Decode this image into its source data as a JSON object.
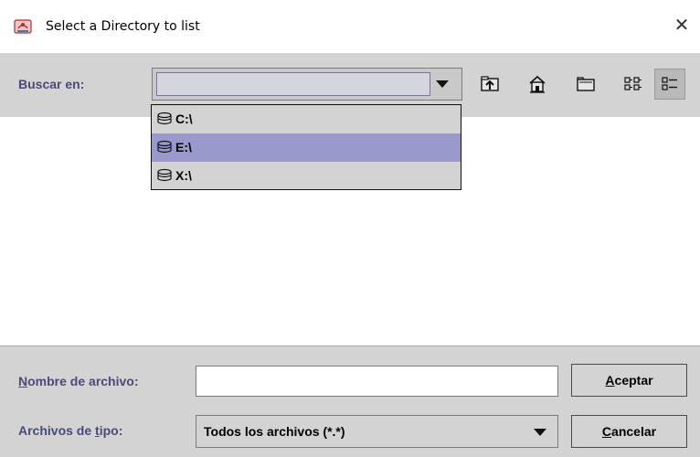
{
  "window": {
    "title": "Select a Directory to list",
    "close_glyph": "✕"
  },
  "toolbar": {
    "look_in_label": "Buscar en:",
    "look_in_value": "",
    "buttons": [
      {
        "name": "up-one-level",
        "icon": "folder-up-icon"
      },
      {
        "name": "home",
        "icon": "home-icon"
      },
      {
        "name": "new-folder",
        "icon": "new-folder-icon"
      },
      {
        "name": "list-view",
        "icon": "list-view-icon"
      },
      {
        "name": "details-view",
        "icon": "details-view-icon",
        "active": true
      }
    ]
  },
  "dropdown": {
    "items": [
      {
        "label": "C:\\",
        "icon": "disk-icon",
        "selected": false
      },
      {
        "label": "E:\\",
        "icon": "disk-icon",
        "selected": true
      },
      {
        "label": "X:\\",
        "icon": "disk-icon",
        "selected": false
      }
    ]
  },
  "file_name": {
    "label_mnemonic": "N",
    "label_rest": "ombre de archivo:",
    "value": ""
  },
  "file_type": {
    "label_before": "Archivos de ",
    "label_mnemonic": "t",
    "label_after": "ipo:",
    "value": "Todos los archivos (*.*)"
  },
  "accept_button": {
    "mnemonic": "A",
    "rest": "ceptar"
  },
  "cancel_button": {
    "mnemonic": "C",
    "rest": "ancelar"
  },
  "colors": {
    "panel": "#d3d3d3",
    "label": "#4a4a7a",
    "selection": "#9999cc"
  }
}
